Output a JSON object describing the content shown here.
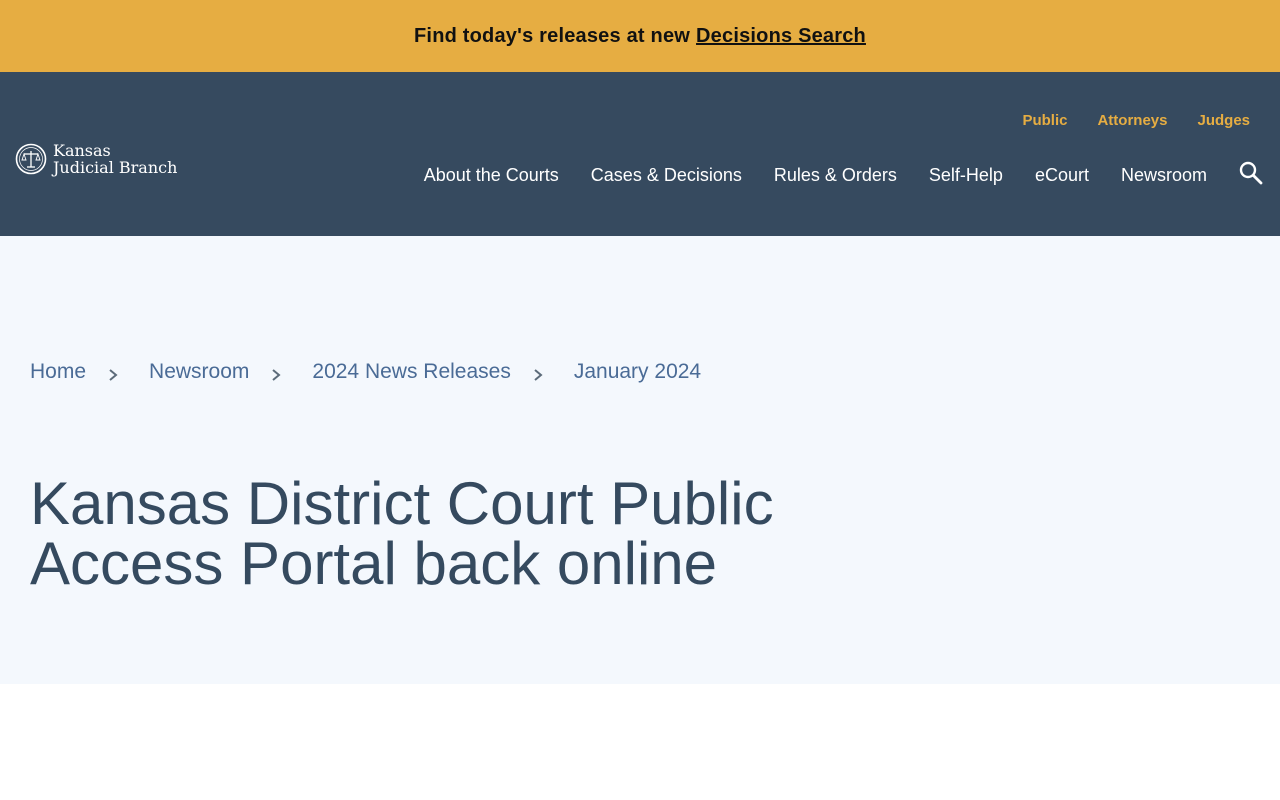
{
  "banner": {
    "text": "Find today's releases at new",
    "link_label": "Decisions Search"
  },
  "header": {
    "logo": {
      "line1": "Kansas",
      "line2": "Judicial Branch"
    },
    "audience_nav": [
      "Public",
      "Attorneys",
      "Judges"
    ],
    "main_nav": [
      "About the Courts",
      "Cases & Decisions",
      "Rules & Orders",
      "Self-Help",
      "eCourt",
      "Newsroom"
    ],
    "search_icon": "search-icon"
  },
  "breadcrumb": [
    "Home",
    "Newsroom",
    "2024 News Releases",
    "January 2024"
  ],
  "page": {
    "title": "Kansas District Court Public Access Portal back online"
  },
  "colors": {
    "banner": "#e6ad42",
    "header": "#364a5f",
    "hero": "#f4f8fd",
    "link": "#4a6b96",
    "title": "#354a5f"
  }
}
